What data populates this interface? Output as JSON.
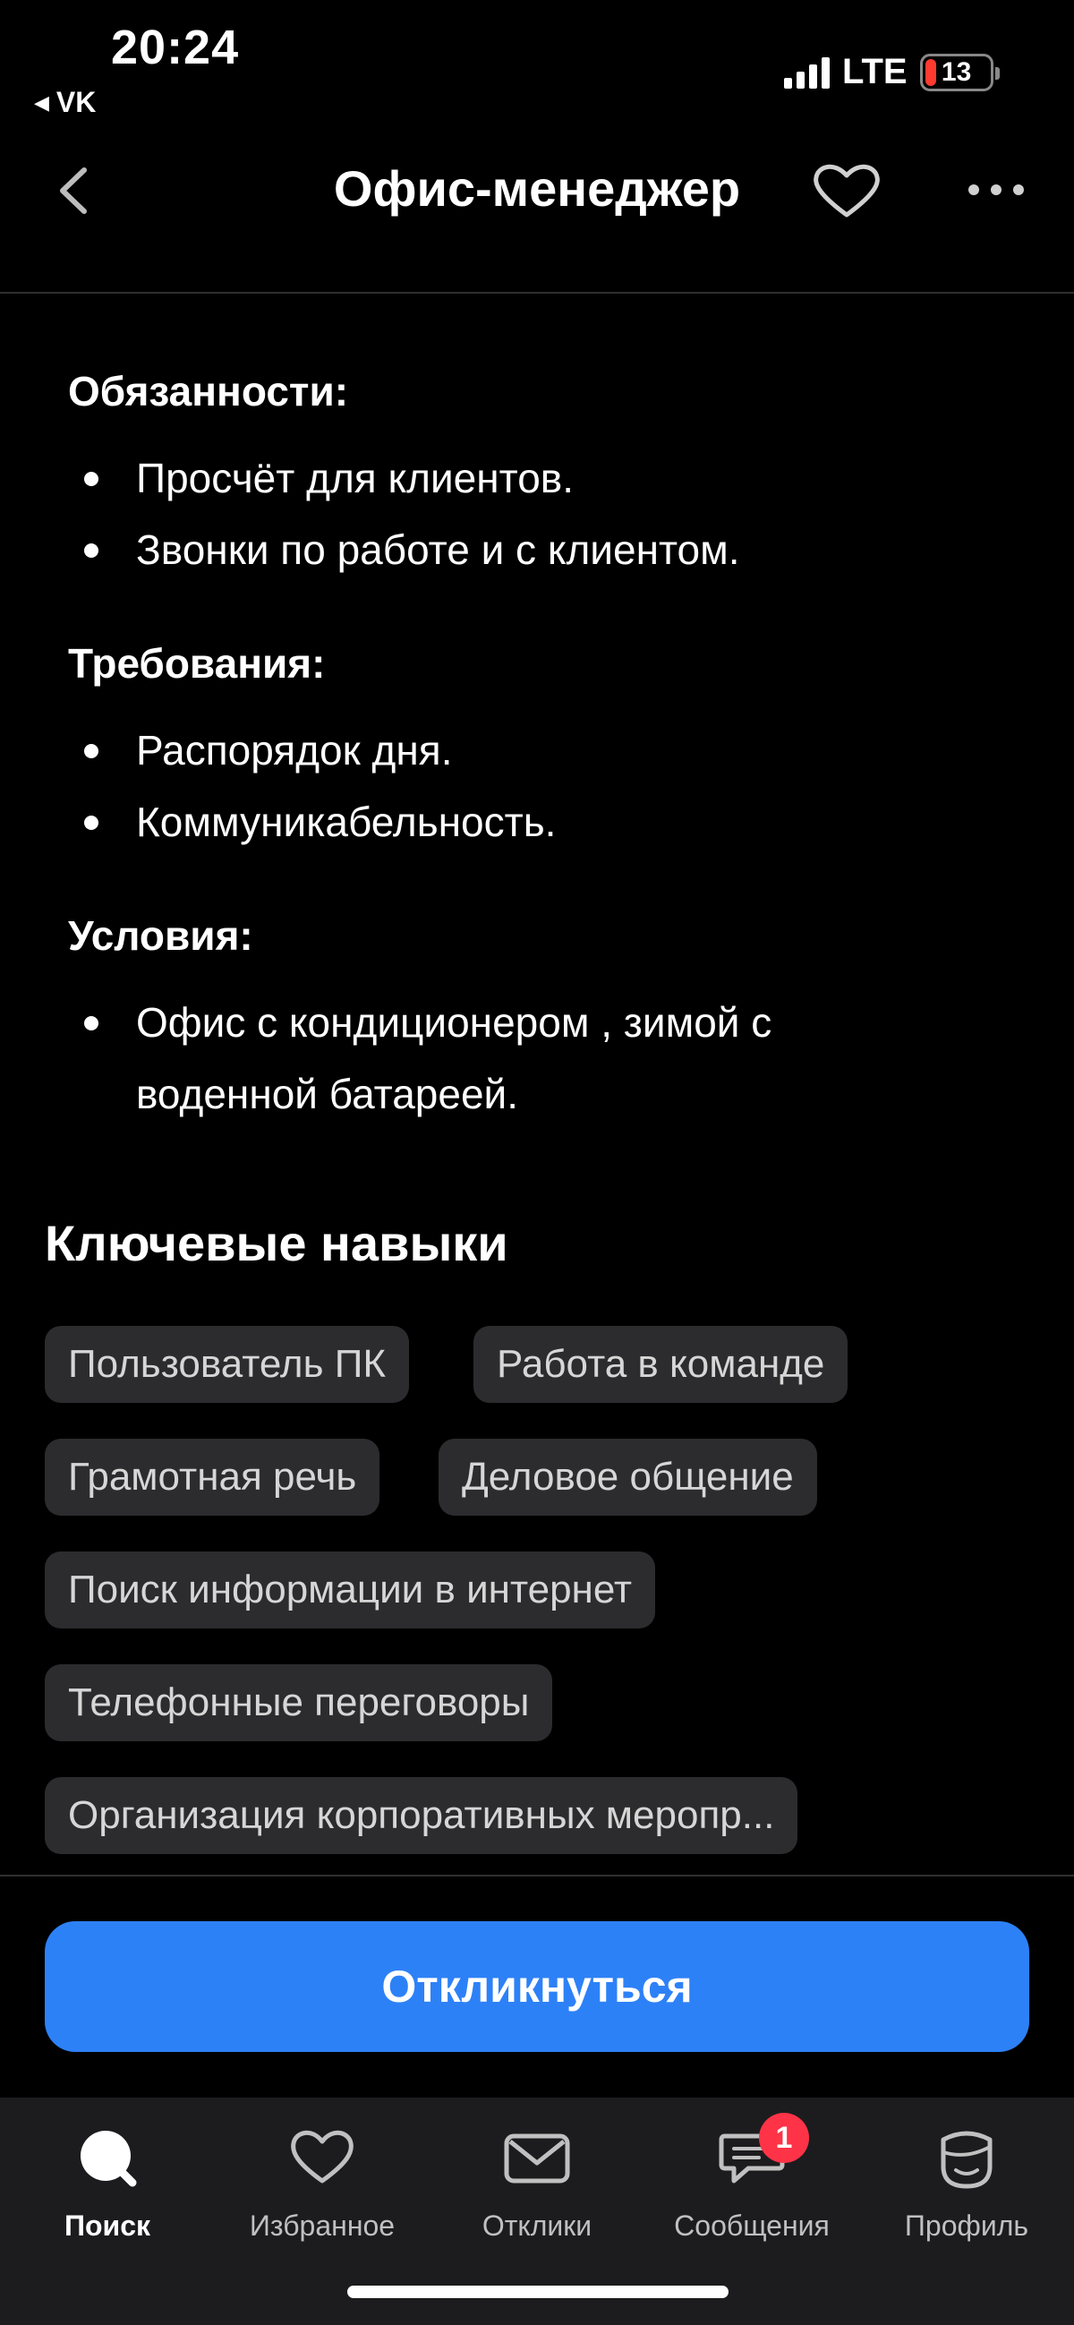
{
  "status_bar": {
    "time": "20:24",
    "back_app": "VK",
    "network": "LTE",
    "battery": "13",
    "battery_color": "#ff3b30"
  },
  "header": {
    "title": "Офис-менеджер"
  },
  "sections": [
    {
      "heading": "Обязанности:",
      "items": [
        "Просчёт для клиентов.",
        "Звонки по работе и с клиентом."
      ]
    },
    {
      "heading": "Требования:",
      "items": [
        "Распорядок дня.",
        "Коммуникабельность."
      ]
    },
    {
      "heading": "Условия:",
      "items": [
        "Офис с кондиционером , зимой с",
        "воденной батареей."
      ]
    }
  ],
  "skills": {
    "title": "Ключевые навыки",
    "chips": [
      "Пользователь ПК",
      "Работа в команде",
      "Грамотная речь",
      "Деловое общение",
      "Поиск информации в интернет",
      "Телефонные переговоры",
      "Организация корпоративных меропр..."
    ]
  },
  "respond_button": {
    "label": "Откликнуться",
    "color": "#2d81f7"
  },
  "tabbar": {
    "tabs": [
      {
        "label": "Поиск",
        "icon": "search-icon",
        "active": true
      },
      {
        "label": "Избранное",
        "icon": "heart-icon",
        "active": false
      },
      {
        "label": "Отклики",
        "icon": "envelope-icon",
        "active": false
      },
      {
        "label": "Сообщения",
        "icon": "chat-icon",
        "active": false,
        "badge": "1"
      },
      {
        "label": "Профиль",
        "icon": "profile-icon",
        "active": false
      }
    ]
  }
}
